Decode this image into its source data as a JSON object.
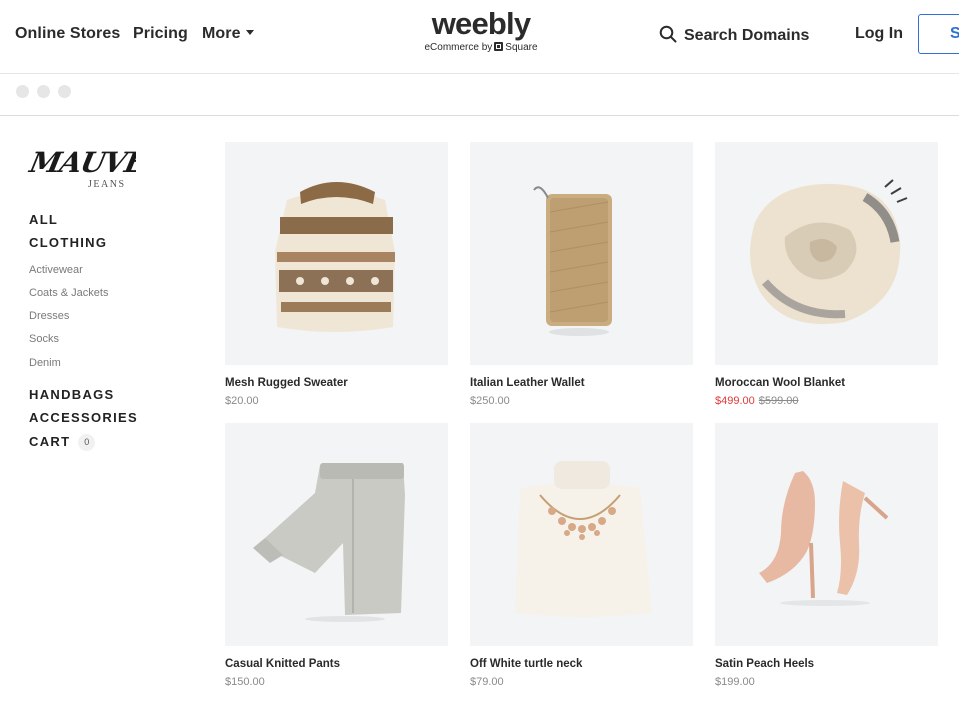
{
  "topnav": {
    "online_stores": "Online Stores",
    "pricing": "Pricing",
    "more": "More",
    "brand": "weebly",
    "brand_sub_prefix": "eCommerce by",
    "brand_sub_suffix": "Square",
    "search_domains": "Search Domains",
    "log_in": "Log In",
    "sign_up_visible": "S",
    "accent_color": "#2e6fd8"
  },
  "store": {
    "logo_text": "MAUVE",
    "logo_sub": "JEANS",
    "nav": {
      "all": "ALL",
      "clothing": "CLOTHING",
      "subcategories": [
        "Activewear",
        "Coats & Jackets",
        "Dresses",
        "Socks",
        "Denim"
      ],
      "handbags": "HANDBAGS",
      "accessories": "ACCESSORIES",
      "cart": "CART",
      "cart_count": "0"
    }
  },
  "products": [
    {
      "name": "Mesh Rugged Sweater",
      "price": "$20.00",
      "image": "sweater-image"
    },
    {
      "name": "Italian Leather Wallet",
      "price": "$250.00",
      "image": "wallet-image"
    },
    {
      "name": "Moroccan Wool Blanket",
      "sale_price": "$499.00",
      "original_price": "$599.00",
      "image": "blanket-image",
      "sale_color": "#e03a3a"
    },
    {
      "name": "Casual Knitted Pants",
      "price": "$150.00",
      "image": "pants-image"
    },
    {
      "name": "Off White turtle neck",
      "price": "$79.00",
      "image": "turtleneck-image"
    },
    {
      "name": "Satin Peach Heels",
      "price": "$199.00",
      "image": "heels-image"
    }
  ]
}
